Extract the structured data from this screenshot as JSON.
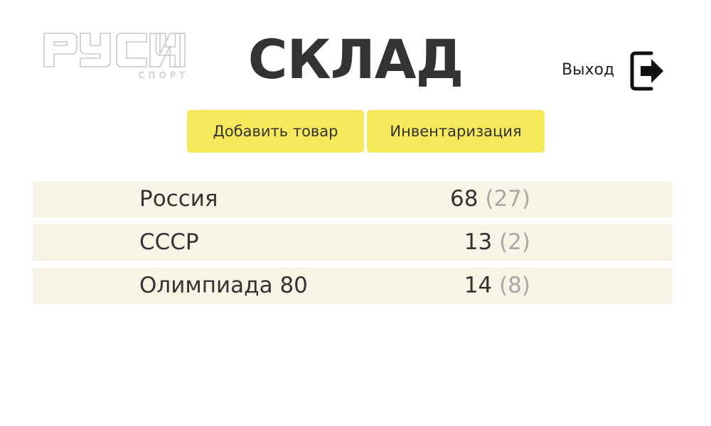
{
  "header": {
    "logo": {
      "text": "РУСИЧ",
      "subtitle": "СПОРТ",
      "icon": "rusich-sport-logo"
    },
    "title": "СКЛАД",
    "logout_label": "Выход",
    "logout_icon": "logout-icon"
  },
  "toolbar": {
    "add_label": "Добавить товар",
    "inventory_label": "Инвентаризация",
    "button_color": "#f5e85a"
  },
  "items": [
    {
      "name": "Россия",
      "count": "68",
      "reserved": "(27)"
    },
    {
      "name": "СССР",
      "count": "13",
      "reserved": "(2)"
    },
    {
      "name": "Олимпиада 80",
      "count": "14",
      "reserved": "(8)"
    }
  ],
  "colors": {
    "row_background": "#f7f4e6",
    "reserved_text": "#a8a8a8",
    "text": "#333333"
  }
}
